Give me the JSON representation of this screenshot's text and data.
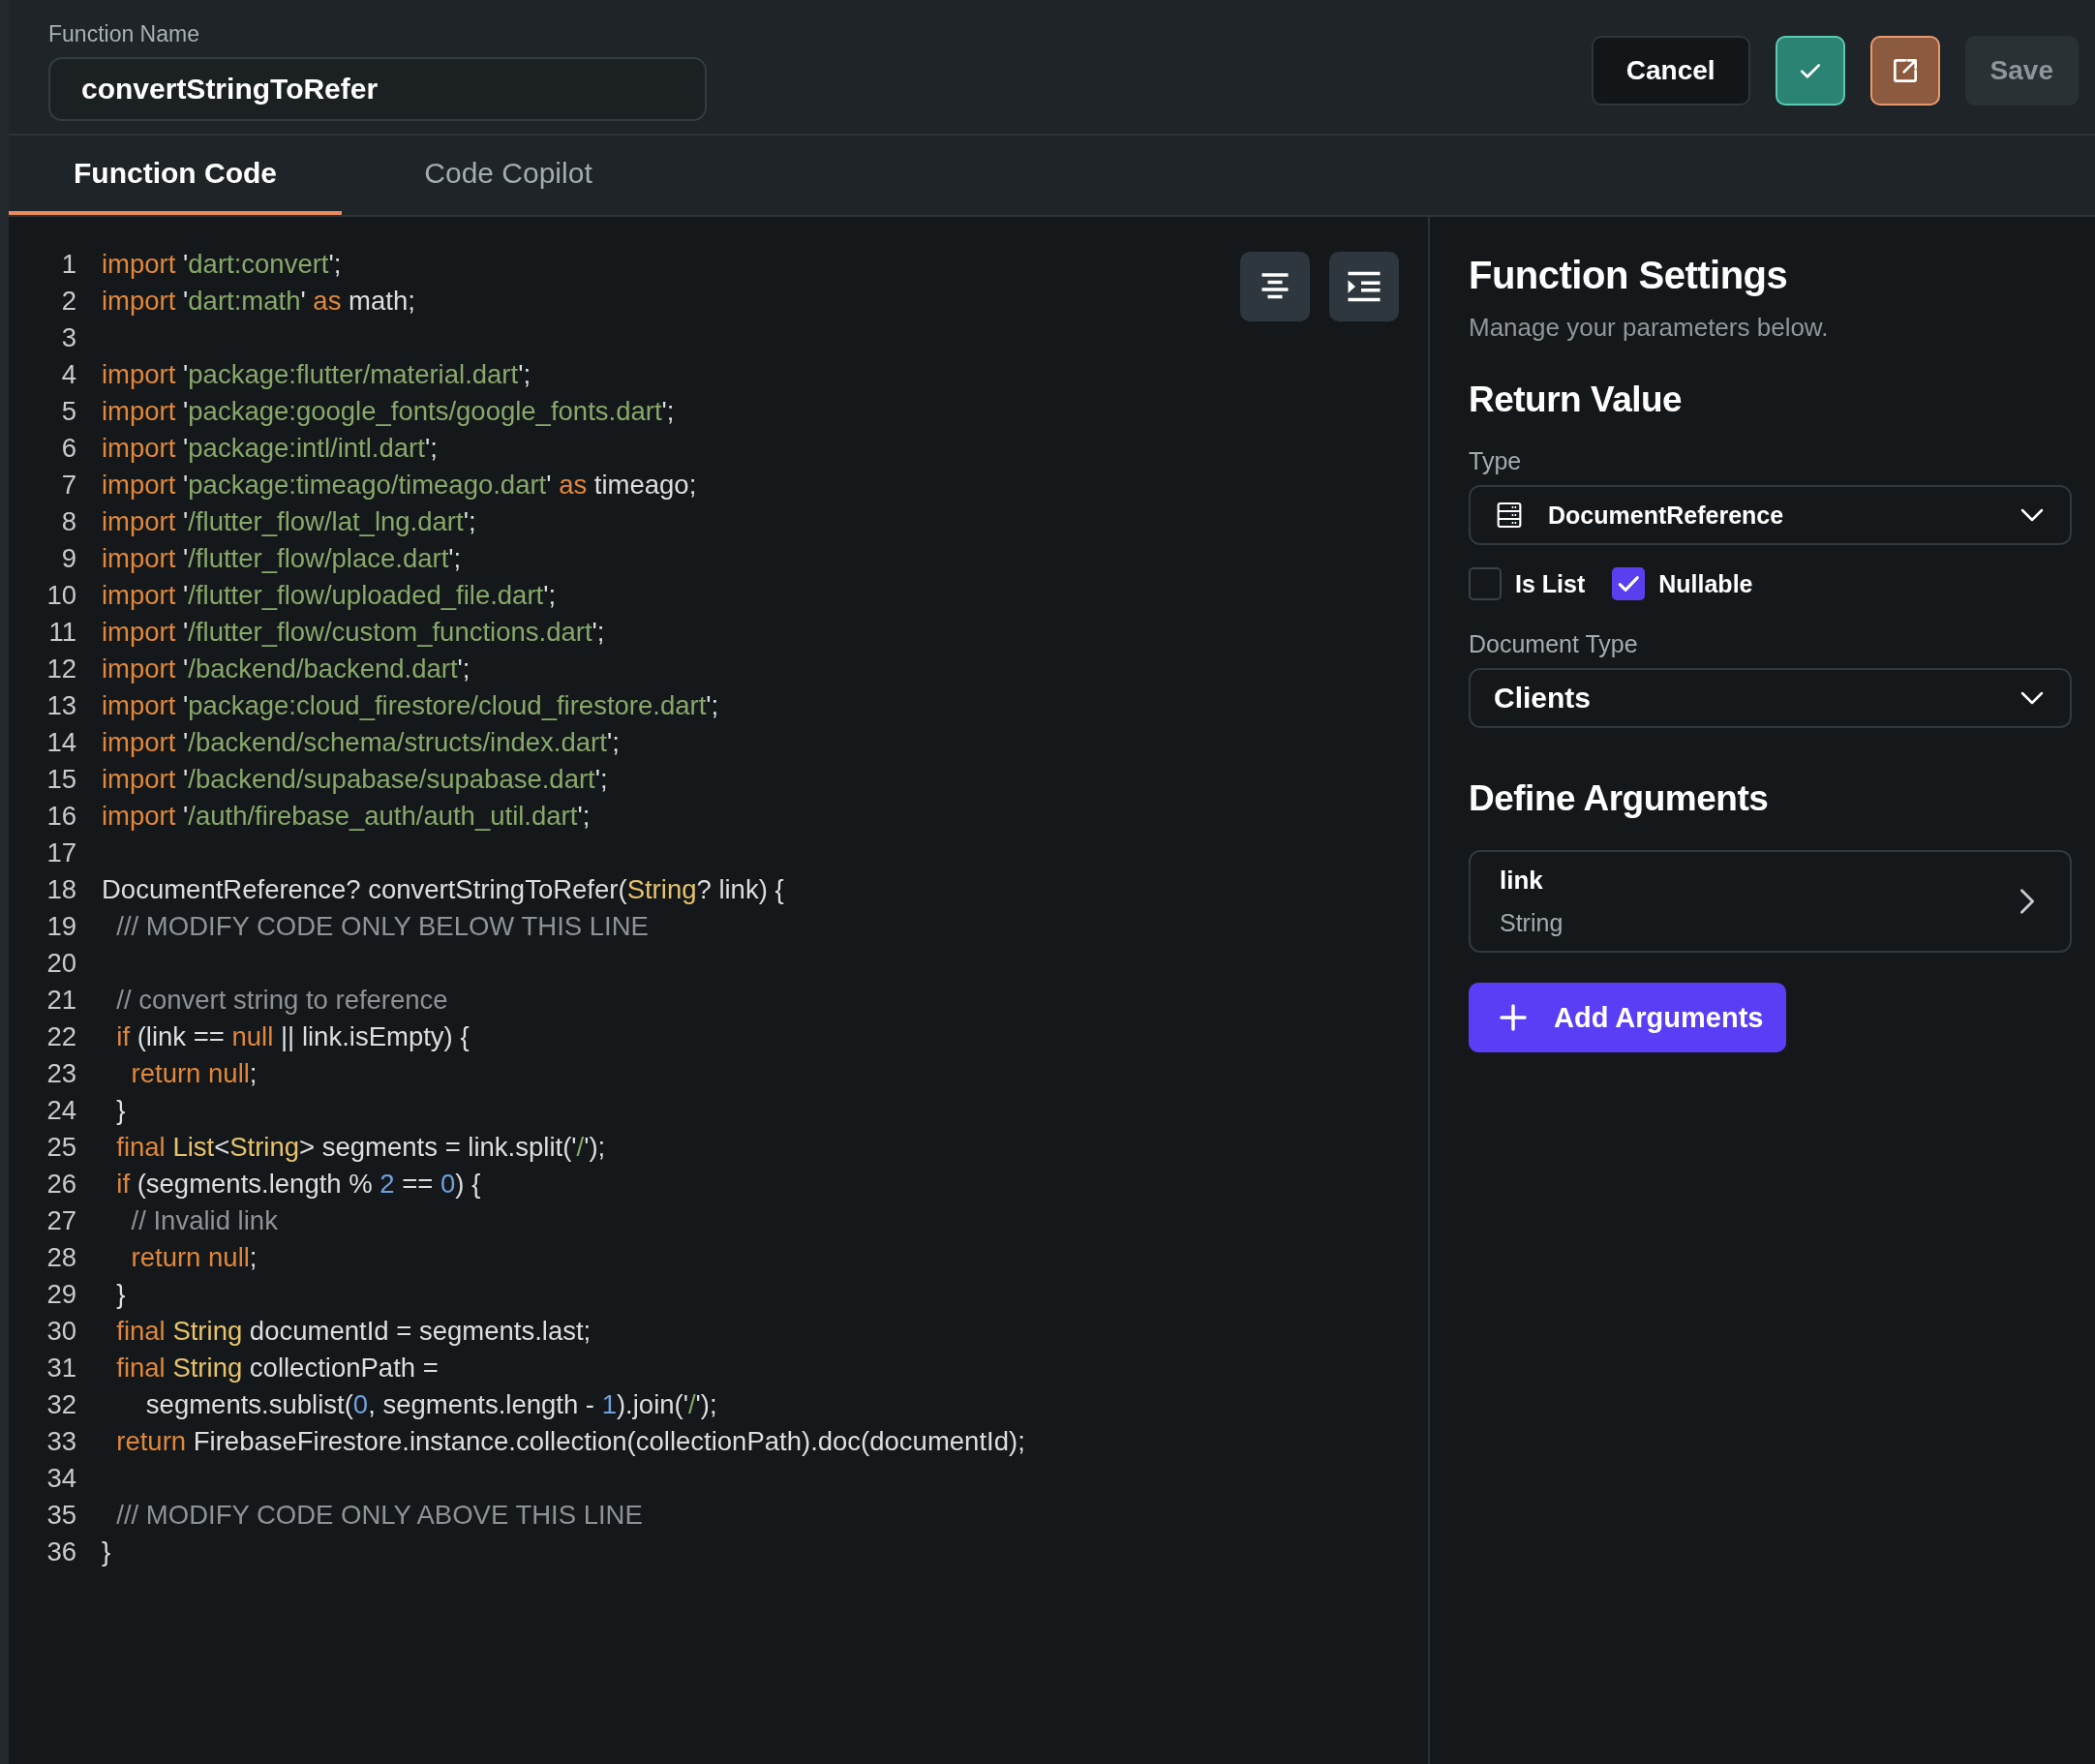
{
  "function_name": {
    "label": "Function Name",
    "value": "convertStringToRefer"
  },
  "header_buttons": [
    {
      "kind": "text",
      "label": "Cancel",
      "disabled": false
    },
    {
      "kind": "confirm"
    },
    {
      "kind": "open-external"
    },
    {
      "kind": "text",
      "label": "Save",
      "disabled": true
    }
  ],
  "tabs": [
    {
      "label": "Function Code",
      "selected": true
    },
    {
      "label": "Code Copilot",
      "selected": false
    }
  ],
  "editor": {
    "tools": [
      {
        "kind": "align-center"
      },
      {
        "kind": "indent"
      }
    ],
    "lines": [
      {
        "number": "1",
        "tokens": [
          {
            "kind": "keyword",
            "text": "import"
          },
          {
            "kind": "plain",
            "text": " '"
          },
          {
            "kind": "string",
            "text": "dart:convert"
          },
          {
            "kind": "plain",
            "text": "';"
          }
        ]
      },
      {
        "number": "2",
        "tokens": [
          {
            "kind": "keyword",
            "text": "import"
          },
          {
            "kind": "plain",
            "text": " '"
          },
          {
            "kind": "string",
            "text": "dart:math"
          },
          {
            "kind": "plain",
            "text": "' "
          },
          {
            "kind": "keyword",
            "text": "as"
          },
          {
            "kind": "plain",
            "text": " math;"
          }
        ]
      },
      {
        "number": "3"
      },
      {
        "number": "4",
        "tokens": [
          {
            "kind": "keyword",
            "text": "import"
          },
          {
            "kind": "plain",
            "text": " '"
          },
          {
            "kind": "string",
            "text": "package:flutter/material.dart"
          },
          {
            "kind": "plain",
            "text": "';"
          }
        ]
      },
      {
        "number": "5",
        "tokens": [
          {
            "kind": "keyword",
            "text": "import"
          },
          {
            "kind": "plain",
            "text": " '"
          },
          {
            "kind": "string",
            "text": "package:google_fonts/google_fonts.dart"
          },
          {
            "kind": "plain",
            "text": "';"
          }
        ]
      },
      {
        "number": "6",
        "tokens": [
          {
            "kind": "keyword",
            "text": "import"
          },
          {
            "kind": "plain",
            "text": " '"
          },
          {
            "kind": "string",
            "text": "package:intl/intl.dart"
          },
          {
            "kind": "plain",
            "text": "';"
          }
        ]
      },
      {
        "number": "7",
        "tokens": [
          {
            "kind": "keyword",
            "text": "import"
          },
          {
            "kind": "plain",
            "text": " '"
          },
          {
            "kind": "string",
            "text": "package:timeago/timeago.dart"
          },
          {
            "kind": "plain",
            "text": "' "
          },
          {
            "kind": "keyword",
            "text": "as"
          },
          {
            "kind": "plain",
            "text": " timeago;"
          }
        ]
      },
      {
        "number": "8",
        "tokens": [
          {
            "kind": "keyword",
            "text": "import"
          },
          {
            "kind": "plain",
            "text": " '"
          },
          {
            "kind": "string",
            "text": "/flutter_flow/lat_lng.dart"
          },
          {
            "kind": "plain",
            "text": "';"
          }
        ]
      },
      {
        "number": "9",
        "tokens": [
          {
            "kind": "keyword",
            "text": "import"
          },
          {
            "kind": "plain",
            "text": " '"
          },
          {
            "kind": "string",
            "text": "/flutter_flow/place.dart"
          },
          {
            "kind": "plain",
            "text": "';"
          }
        ]
      },
      {
        "number": "10",
        "tokens": [
          {
            "kind": "keyword",
            "text": "import"
          },
          {
            "kind": "plain",
            "text": " '"
          },
          {
            "kind": "string",
            "text": "/flutter_flow/uploaded_file.dart"
          },
          {
            "kind": "plain",
            "text": "';"
          }
        ]
      },
      {
        "number": "11",
        "tokens": [
          {
            "kind": "keyword",
            "text": "import"
          },
          {
            "kind": "plain",
            "text": " '"
          },
          {
            "kind": "string",
            "text": "/flutter_flow/custom_functions.dart"
          },
          {
            "kind": "plain",
            "text": "';"
          }
        ]
      },
      {
        "number": "12",
        "tokens": [
          {
            "kind": "keyword",
            "text": "import"
          },
          {
            "kind": "plain",
            "text": " '"
          },
          {
            "kind": "string",
            "text": "/backend/backend.dart"
          },
          {
            "kind": "plain",
            "text": "';"
          }
        ]
      },
      {
        "number": "13",
        "tokens": [
          {
            "kind": "keyword",
            "text": "import"
          },
          {
            "kind": "plain",
            "text": " '"
          },
          {
            "kind": "string",
            "text": "package:cloud_firestore/cloud_firestore.dart"
          },
          {
            "kind": "plain",
            "text": "';"
          }
        ]
      },
      {
        "number": "14",
        "tokens": [
          {
            "kind": "keyword",
            "text": "import"
          },
          {
            "kind": "plain",
            "text": " '"
          },
          {
            "kind": "string",
            "text": "/backend/schema/structs/index.dart"
          },
          {
            "kind": "plain",
            "text": "';"
          }
        ]
      },
      {
        "number": "15",
        "tokens": [
          {
            "kind": "keyword",
            "text": "import"
          },
          {
            "kind": "plain",
            "text": " '"
          },
          {
            "kind": "string",
            "text": "/backend/supabase/supabase.dart"
          },
          {
            "kind": "plain",
            "text": "';"
          }
        ]
      },
      {
        "number": "16",
        "tokens": [
          {
            "kind": "keyword",
            "text": "import"
          },
          {
            "kind": "plain",
            "text": " '"
          },
          {
            "kind": "string",
            "text": "/auth/firebase_auth/auth_util.dart"
          },
          {
            "kind": "plain",
            "text": "';"
          }
        ]
      },
      {
        "number": "17"
      },
      {
        "number": "18",
        "tokens": [
          {
            "kind": "plain",
            "text": "DocumentReference? convertStringToRefer("
          },
          {
            "kind": "type",
            "text": "String"
          },
          {
            "kind": "plain",
            "text": "? link) {"
          }
        ]
      },
      {
        "number": "19",
        "tokens": [
          {
            "kind": "comment",
            "text": "  /// MODIFY CODE ONLY BELOW THIS LINE"
          }
        ]
      },
      {
        "number": "20"
      },
      {
        "number": "21",
        "tokens": [
          {
            "kind": "comment",
            "text": "  // convert string to reference"
          }
        ]
      },
      {
        "number": "22",
        "tokens": [
          {
            "kind": "keyword",
            "text": "  if"
          },
          {
            "kind": "plain",
            "text": " (link == "
          },
          {
            "kind": "keyword",
            "text": "null"
          },
          {
            "kind": "plain",
            "text": " || link.isEmpty) {"
          }
        ]
      },
      {
        "number": "23",
        "tokens": [
          {
            "kind": "keyword",
            "text": "    return null"
          },
          {
            "kind": "plain",
            "text": ";"
          }
        ]
      },
      {
        "number": "24",
        "tokens": [
          {
            "kind": "plain",
            "text": "  }"
          }
        ]
      },
      {
        "number": "25",
        "tokens": [
          {
            "kind": "keyword",
            "text": "  final "
          },
          {
            "kind": "type",
            "text": "List"
          },
          {
            "kind": "plain",
            "text": "<"
          },
          {
            "kind": "type",
            "text": "String"
          },
          {
            "kind": "plain",
            "text": "> segments = link.split('"
          },
          {
            "kind": "string",
            "text": "/"
          },
          {
            "kind": "plain",
            "text": "');"
          }
        ]
      },
      {
        "number": "26",
        "tokens": [
          {
            "kind": "keyword",
            "text": "  if"
          },
          {
            "kind": "plain",
            "text": " (segments.length % "
          },
          {
            "kind": "number",
            "text": "2"
          },
          {
            "kind": "plain",
            "text": " == "
          },
          {
            "kind": "number",
            "text": "0"
          },
          {
            "kind": "plain",
            "text": ") {"
          }
        ]
      },
      {
        "number": "27",
        "tokens": [
          {
            "kind": "comment",
            "text": "    // Invalid link"
          }
        ]
      },
      {
        "number": "28",
        "tokens": [
          {
            "kind": "keyword",
            "text": "    return null"
          },
          {
            "kind": "plain",
            "text": ";"
          }
        ]
      },
      {
        "number": "29",
        "tokens": [
          {
            "kind": "plain",
            "text": "  }"
          }
        ]
      },
      {
        "number": "30",
        "tokens": [
          {
            "kind": "keyword",
            "text": "  final "
          },
          {
            "kind": "type",
            "text": "String"
          },
          {
            "kind": "plain",
            "text": " documentId = segments.last;"
          }
        ]
      },
      {
        "number": "31",
        "tokens": [
          {
            "kind": "keyword",
            "text": "  final "
          },
          {
            "kind": "type",
            "text": "String"
          },
          {
            "kind": "plain",
            "text": " collectionPath ="
          }
        ]
      },
      {
        "number": "32",
        "tokens": [
          {
            "kind": "plain",
            "text": "      segments.sublist("
          },
          {
            "kind": "number",
            "text": "0"
          },
          {
            "kind": "plain",
            "text": ", segments.length - "
          },
          {
            "kind": "number",
            "text": "1"
          },
          {
            "kind": "plain",
            "text": ").join('"
          },
          {
            "kind": "string",
            "text": "/"
          },
          {
            "kind": "plain",
            "text": "');"
          }
        ]
      },
      {
        "number": "33",
        "tokens": [
          {
            "kind": "keyword",
            "text": "  return"
          },
          {
            "kind": "plain",
            "text": " FirebaseFirestore.instance.collection(collectionPath).doc(documentId);"
          }
        ]
      },
      {
        "number": "34"
      },
      {
        "number": "35",
        "tokens": [
          {
            "kind": "comment",
            "text": "  /// MODIFY CODE ONLY ABOVE THIS LINE"
          }
        ]
      },
      {
        "number": "36",
        "tokens": [
          {
            "kind": "plain",
            "text": "}"
          }
        ]
      }
    ]
  },
  "settings": {
    "title": "Function Settings",
    "subtitle": "Manage your parameters below.",
    "return_value": {
      "title": "Return Value",
      "type_label": "Type",
      "type_value": "DocumentReference",
      "options": [
        {
          "label": "Is List",
          "checked": false
        },
        {
          "label": "Nullable",
          "checked": true
        }
      ],
      "document_type_label": "Document Type",
      "document_type_value": "Clients"
    },
    "arguments": {
      "title": "Define Arguments",
      "items": [
        {
          "name": "link",
          "type": "String"
        }
      ],
      "add_button": "Add Arguments"
    }
  }
}
